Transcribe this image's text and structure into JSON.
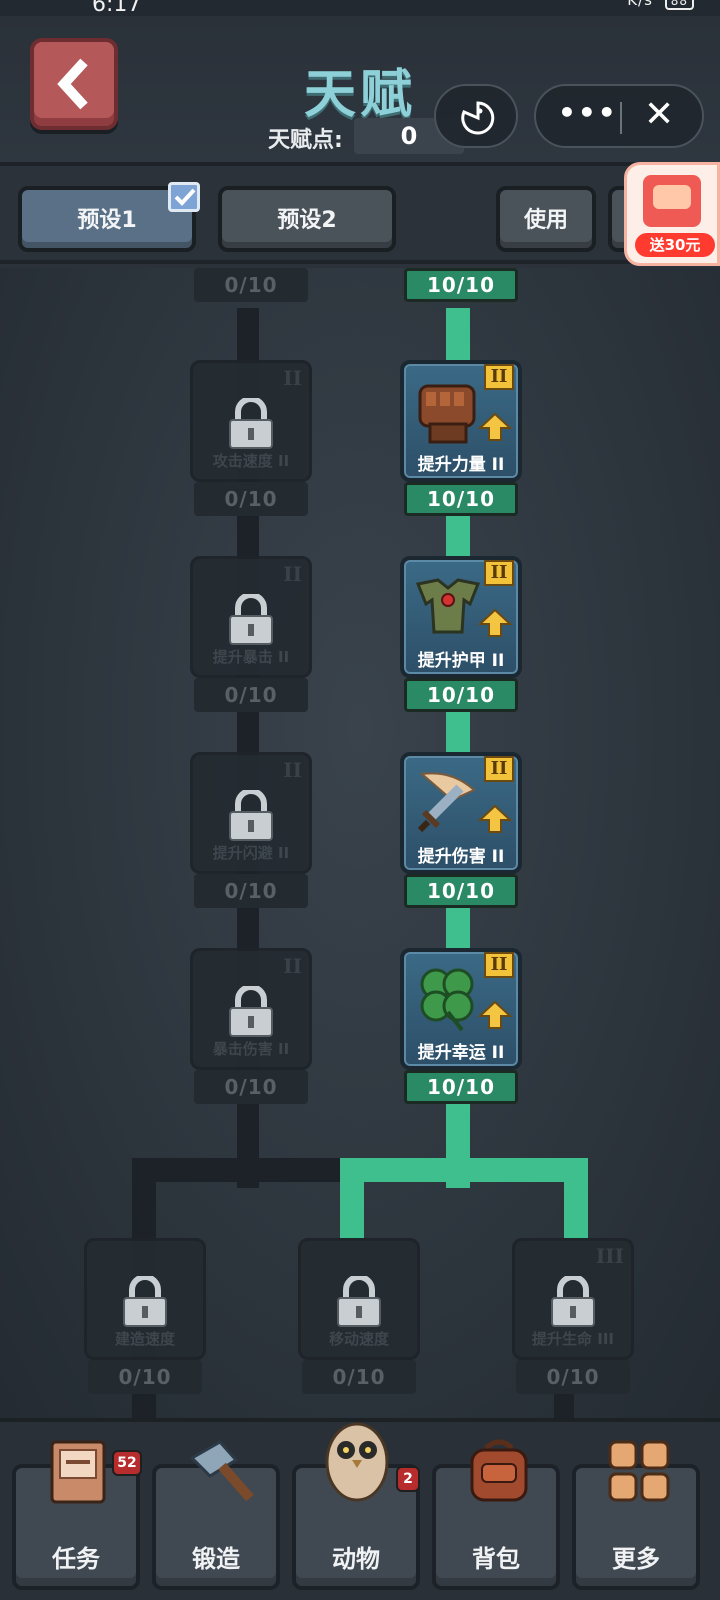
{
  "status_bar": {
    "time": "6:17",
    "network_speed": "K/s",
    "battery": "88"
  },
  "header": {
    "title": "天赋",
    "points_label": "天赋点:",
    "points_value": "0"
  },
  "presets": {
    "preset1": "预设1",
    "preset2": "预设2",
    "use": "使用",
    "selected": "预设1"
  },
  "promo": {
    "label": "送30元"
  },
  "tree": {
    "left_column": [
      {
        "name": "",
        "count": "0/10"
      },
      {
        "name": "攻击速度 II",
        "count": "0/10",
        "roman": "II"
      },
      {
        "name": "提升暴击 II",
        "count": "0/10",
        "roman": "II"
      },
      {
        "name": "提升闪避 II",
        "count": "0/10",
        "roman": "II"
      },
      {
        "name": "暴击伤害 II",
        "count": "0/10",
        "roman": "II"
      }
    ],
    "right_column": [
      {
        "name": "",
        "count": "10/10"
      },
      {
        "name": "提升力量 II",
        "count": "10/10",
        "roman": "II"
      },
      {
        "name": "提升护甲 II",
        "count": "10/10",
        "roman": "II"
      },
      {
        "name": "提升伤害 II",
        "count": "10/10",
        "roman": "II"
      },
      {
        "name": "提升幸运 II",
        "count": "10/10",
        "roman": "II"
      }
    ],
    "bottom_row": [
      {
        "name": "建造速度",
        "count": "0/10"
      },
      {
        "name": "移动速度",
        "count": "0/10"
      },
      {
        "name": "提升生命 III",
        "count": "0/10",
        "roman": "III"
      }
    ]
  },
  "nav": {
    "tasks": {
      "label": "任务",
      "badge": "52"
    },
    "forge": {
      "label": "锻造"
    },
    "animals": {
      "label": "动物",
      "badge": "2"
    },
    "bag": {
      "label": "背包"
    },
    "more": {
      "label": "更多"
    }
  },
  "colors": {
    "active_path": "#3fbf8e",
    "title": "#8ed0d7",
    "back_button": "#b4585a"
  }
}
